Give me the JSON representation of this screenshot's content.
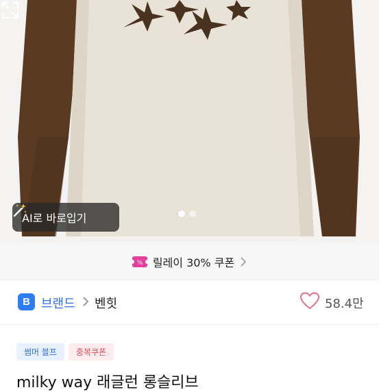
{
  "hero": {
    "ai_button_label": "AI로 바로입기",
    "carousel_dots": 2,
    "carousel_active_index": 0
  },
  "coupon_bar": {
    "label": "릴레이 30% 쿠폰"
  },
  "brand": {
    "badge": "B",
    "label": "브랜드",
    "name": "벤힛",
    "likes": "58.4만"
  },
  "tags": {
    "first": "썸머 블프",
    "second": "중복쿠폰"
  },
  "product": {
    "title": "milky way 래글런 롱슬리브"
  },
  "colors": {
    "brand_blue": "#2e7cf6",
    "heart_pink": "#e1708a",
    "sleeve_brown": "#5a3b22",
    "body_cream": "#e9e3d7"
  }
}
